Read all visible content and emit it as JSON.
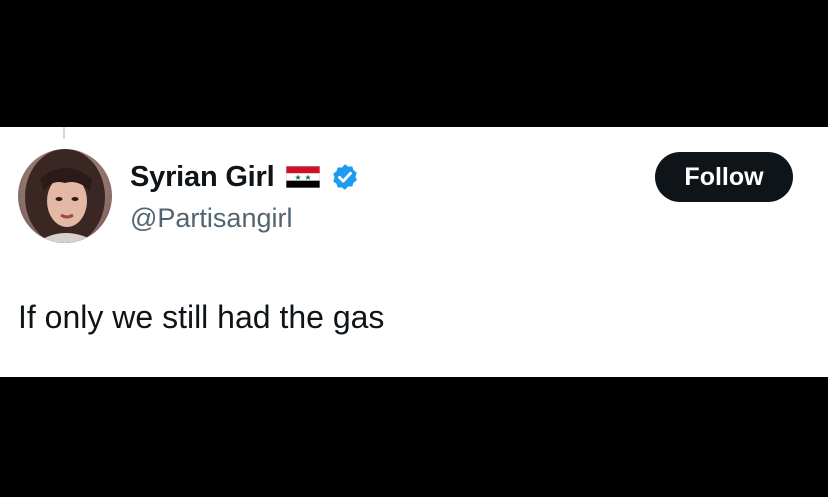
{
  "tweet": {
    "author": {
      "display_name": "Syrian Girl",
      "handle": "@Partisangirl",
      "flag_icon": "syria-flag-icon",
      "verified_icon": "verified-badge-icon",
      "avatar_icon": "profile-avatar"
    },
    "follow_label": "Follow",
    "text": "If only we still had the gas"
  },
  "colors": {
    "background": "#000000",
    "card": "#ffffff",
    "text_primary": "#0f1419",
    "text_secondary": "#536471",
    "verified": "#1d9bf0",
    "follow_bg": "#0f1419",
    "follow_text": "#ffffff"
  }
}
